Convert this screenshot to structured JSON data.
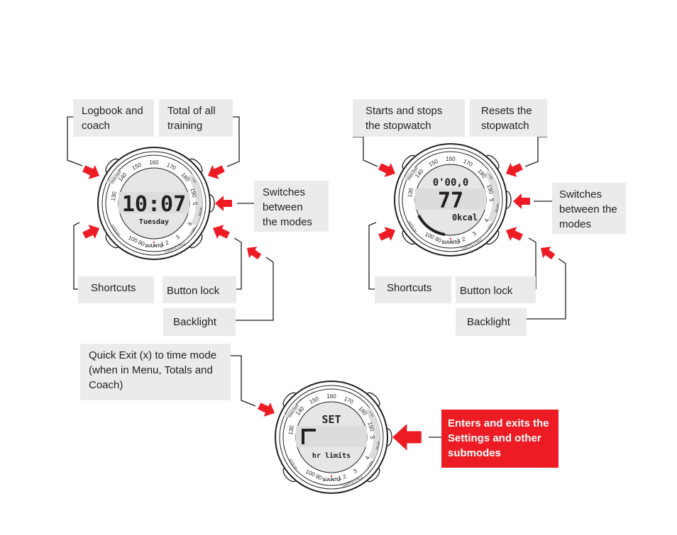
{
  "colors": {
    "accent_red": "#ed1c24",
    "label_bg": "#ebebeb",
    "text": "#231f20"
  },
  "watch_common": {
    "bezel_numbers": [
      "130",
      "140",
      "150",
      "160",
      "170",
      "180",
      "190"
    ],
    "bezel_small": [
      "100 80",
      "5",
      "4",
      "3",
      "1 2"
    ],
    "bezel_labels": [
      "Start Stop",
      "Alt Back",
      "Lap",
      "Mode",
      "Light",
      "Training Effect"
    ],
    "brand": "SUUNTO"
  },
  "diagram1": {
    "display": {
      "line1": "",
      "line2": "10:07",
      "line3": "Tuesday"
    },
    "labels": {
      "logbook": "Logbook and coach",
      "total": "Total of all training",
      "switches": "Switches between the modes",
      "shortcuts": "Shortcuts",
      "button_lock": "Button lock",
      "backlight": "Backlight"
    }
  },
  "diagram2": {
    "display": {
      "line1": "0'00,0",
      "line2": "77",
      "line3": "0kcal"
    },
    "labels": {
      "starts": "Starts and stops the stopwatch",
      "resets": "Resets the stopwatch",
      "switches": "Switches between the modes",
      "shortcuts": "Shortcuts",
      "button_lock": "Button lock",
      "backlight": "Backlight"
    }
  },
  "diagram3": {
    "display": {
      "line1": "SET",
      "line2": "",
      "line3": "hr limits"
    },
    "labels": {
      "quick_exit": "Quick Exit (x) to time mode (when in Menu, Totals and Coach)",
      "enters": "Enters and exits the Settings and other submodes"
    }
  }
}
